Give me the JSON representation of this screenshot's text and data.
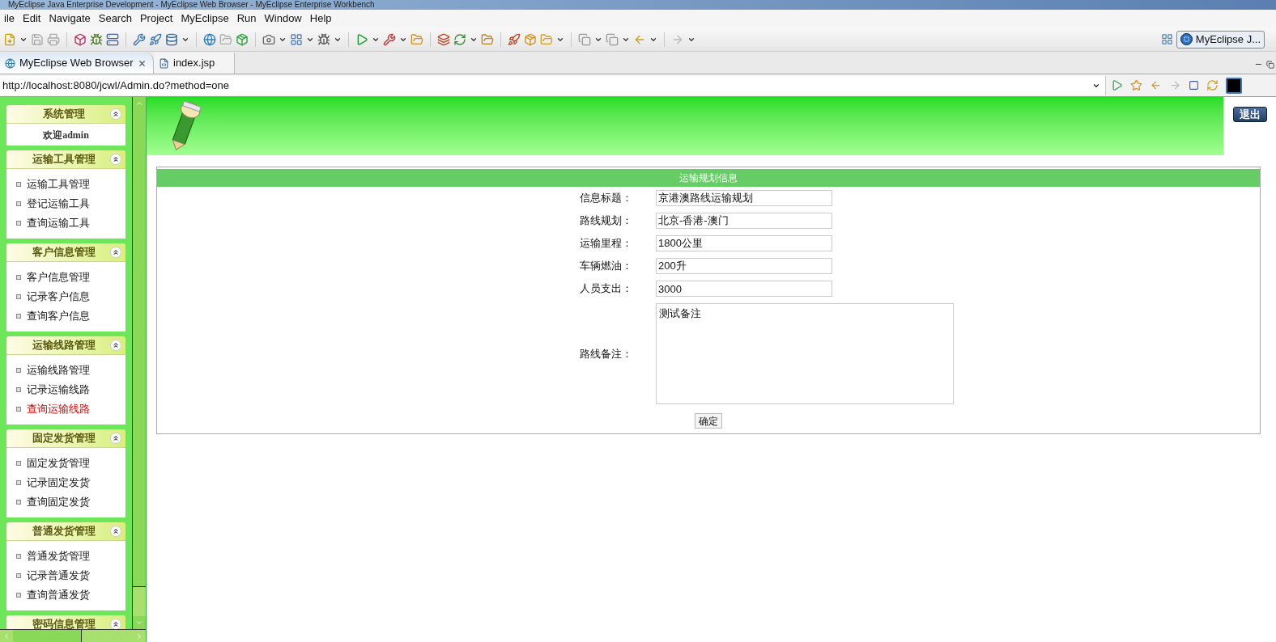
{
  "window": {
    "title": "MyEclipse Java Enterprise Development - MyEclipse Web Browser - MyEclipse Enterprise Workbench"
  },
  "menu": [
    "ile",
    "Edit",
    "Navigate",
    "Search",
    "Project",
    "MyEclipse",
    "Run",
    "Window",
    "Help"
  ],
  "perspective": {
    "label": "MyEclipse J..."
  },
  "editor_tabs": [
    {
      "label": "MyEclipse Web Browser",
      "selected": true,
      "closable": true
    },
    {
      "label": "index.jsp",
      "selected": false,
      "closable": false
    }
  ],
  "browser": {
    "url": "http://localhost:8080/jcwl/Admin.do?method=one"
  },
  "page": {
    "logout_button": "退出",
    "sidebar": [
      {
        "title": "系统管理",
        "expanded": true,
        "kind": "welcome",
        "text": "欢迎admin"
      },
      {
        "title": "运输工具管理",
        "expanded": true,
        "kind": "links",
        "items": [
          {
            "label": "运输工具管理",
            "selected": false
          },
          {
            "label": "登记运输工具",
            "selected": false
          },
          {
            "label": "查询运输工具",
            "selected": false
          }
        ]
      },
      {
        "title": "客户信息管理",
        "expanded": true,
        "kind": "links",
        "items": [
          {
            "label": "客户信息管理",
            "selected": false
          },
          {
            "label": "记录客户信息",
            "selected": false
          },
          {
            "label": "查询客户信息",
            "selected": false
          }
        ]
      },
      {
        "title": "运输线路管理",
        "expanded": true,
        "kind": "links",
        "items": [
          {
            "label": "运输线路管理",
            "selected": false
          },
          {
            "label": "记录运输线路",
            "selected": false
          },
          {
            "label": "查询运输线路",
            "selected": true
          }
        ]
      },
      {
        "title": "固定发货管理",
        "expanded": true,
        "kind": "links",
        "items": [
          {
            "label": "固定发货管理",
            "selected": false
          },
          {
            "label": "记录固定发货",
            "selected": false
          },
          {
            "label": "查询固定发货",
            "selected": false
          }
        ]
      },
      {
        "title": "普通发货管理",
        "expanded": true,
        "kind": "links",
        "items": [
          {
            "label": "普通发货管理",
            "selected": false
          },
          {
            "label": "记录普通发货",
            "selected": false
          },
          {
            "label": "查询普通发货",
            "selected": false
          }
        ]
      },
      {
        "title": "密码信息管理",
        "expanded": true,
        "kind": "links"
      }
    ],
    "form": {
      "title": "运输规划信息",
      "fields": [
        {
          "kind": "text",
          "label": "信息标题：",
          "value": "京港澳路线运输规划"
        },
        {
          "kind": "text",
          "label": "路线规划：",
          "value": "北京-香港-澳门"
        },
        {
          "kind": "text",
          "label": "运输里程：",
          "value": "1800公里"
        },
        {
          "kind": "text",
          "label": "车辆燃油：",
          "value": "200升"
        },
        {
          "kind": "text",
          "label": "人员支出：",
          "value": "3000"
        },
        {
          "kind": "textarea",
          "label": "路线备注：",
          "value": "测试备注"
        }
      ],
      "submit": "确定"
    }
  }
}
